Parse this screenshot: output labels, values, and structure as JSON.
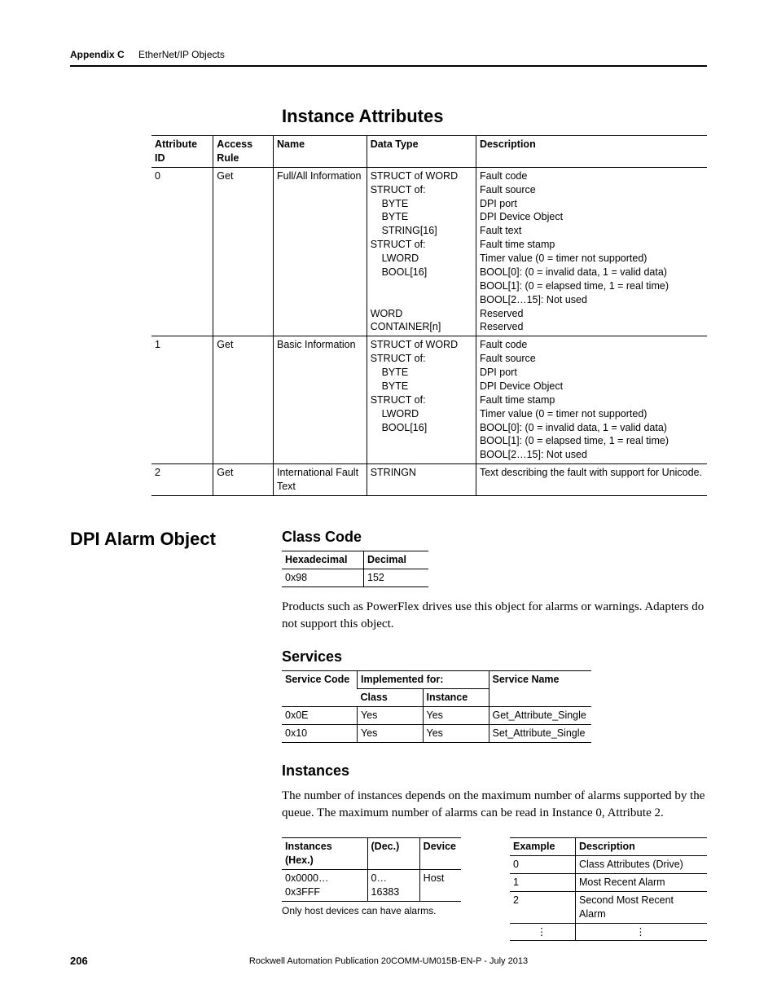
{
  "header": {
    "appendix_label": "Appendix C",
    "chapter_title": "EtherNet/IP Objects"
  },
  "section1": {
    "heading": "Instance Attributes",
    "columns": [
      "Attribute ID",
      "Access Rule",
      "Name",
      "Data Type",
      "Description"
    ],
    "rows": [
      {
        "id": "0",
        "rule": "Get",
        "name": "Full/All Information",
        "datatype": "STRUCT of WORD\nSTRUCT of:\n    BYTE\n    BYTE\n    STRING[16]\nSTRUCT of:\n    LWORD\n    BOOL[16]\n\n\nWORD\nCONTAINER[n]",
        "desc": "Fault code\nFault source\nDPI port\nDPI Device Object\nFault text\nFault time stamp\nTimer value (0 = timer not supported)\nBOOL[0]: (0 = invalid data, 1 = valid data)\nBOOL[1]: (0 = elapsed time, 1 = real time)\nBOOL[2…15]: Not used\nReserved\nReserved"
      },
      {
        "id": "1",
        "rule": "Get",
        "name": "Basic Information",
        "datatype": "STRUCT of WORD\nSTRUCT of:\n    BYTE\n    BYTE\nSTRUCT of:\n    LWORD\n    BOOL[16]",
        "desc": "Fault code\nFault source\nDPI port\nDPI Device Object\nFault time stamp\nTimer value (0 = timer not supported)\nBOOL[0]: (0 = invalid data, 1 = valid data)\nBOOL[1]: (0 = elapsed time, 1 = real time)\nBOOL[2…15]: Not used"
      },
      {
        "id": "2",
        "rule": "Get",
        "name": "International Fault Text",
        "datatype": "STRINGN",
        "desc": "Text describing the fault with support for Unicode."
      }
    ]
  },
  "section2": {
    "side_heading": "DPI Alarm Object",
    "class_code": {
      "heading": "Class Code",
      "columns": [
        "Hexadecimal",
        "Decimal"
      ],
      "row": [
        "0x98",
        "152"
      ]
    },
    "intro_text": "Products such as PowerFlex drives use this object for alarms or warnings. Adapters do not support this object.",
    "services": {
      "heading": "Services",
      "columns": [
        "Service Code",
        "Implemented for:",
        "Service Name"
      ],
      "subcolumns": [
        "Class",
        "Instance"
      ],
      "rows": [
        [
          "0x0E",
          "Yes",
          "Yes",
          "Get_Attribute_Single"
        ],
        [
          "0x10",
          "Yes",
          "Yes",
          "Set_Attribute_Single"
        ]
      ]
    },
    "instances": {
      "heading": "Instances",
      "intro": "The number of instances depends on the maximum number of alarms supported by the queue. The maximum number of alarms can be read in Instance 0, Attribute 2.",
      "table1": {
        "columns": [
          "Instances (Hex.)",
          "(Dec.)",
          "Device"
        ],
        "row": [
          "0x0000…0x3FFF",
          "0…16383",
          "Host"
        ],
        "note": "Only host devices can have alarms."
      },
      "table2": {
        "columns": [
          "Example",
          "Description"
        ],
        "rows": [
          [
            "0",
            "Class Attributes (Drive)"
          ],
          [
            "1",
            "Most Recent Alarm"
          ],
          [
            "2",
            "Second Most Recent Alarm"
          ],
          [
            "⋮",
            "⋮"
          ]
        ]
      }
    }
  },
  "footer": {
    "page_number": "206",
    "publication": "Rockwell Automation Publication 20COMM-UM015B-EN-P - July 2013"
  }
}
